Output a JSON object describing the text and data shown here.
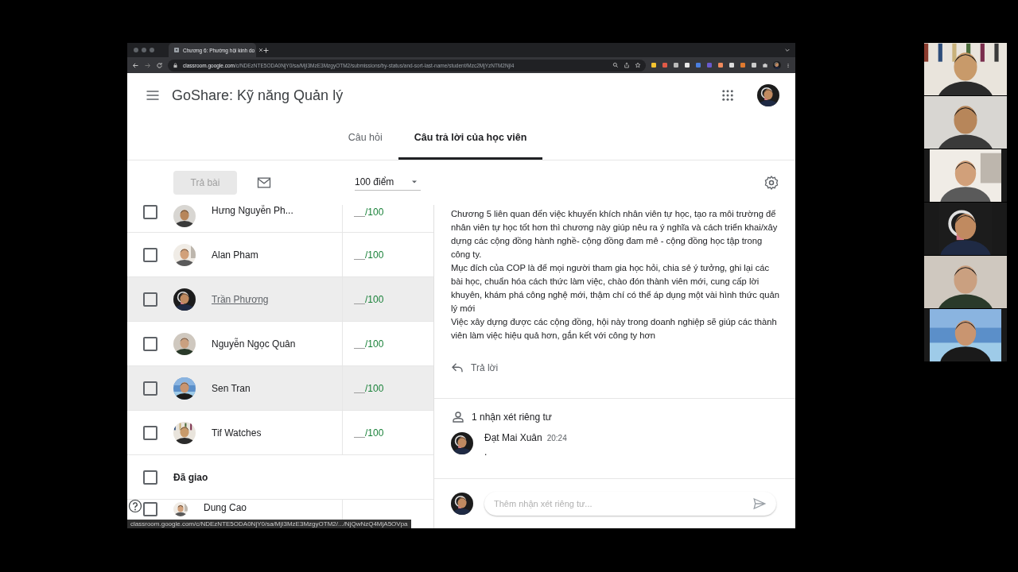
{
  "browser": {
    "tab_title": "Chương 6: Phường hội kinh do",
    "url_host": "classroom.google.com",
    "url_path": "/c/NDEzNTE5ODA0NjY0/sa/MjI3MzE3MzgyOTM2/submissions/by-status/and-sort-last-name/student/Mzc2MjYzNTM2NjI4"
  },
  "app": {
    "title": "GoShare: Kỹ năng Quản lý"
  },
  "tabs": [
    {
      "label": "Câu hỏi",
      "selected": false
    },
    {
      "label": "Câu trả lời của học viên",
      "selected": true
    }
  ],
  "toolbar": {
    "return_button": {
      "label": "Trả bài",
      "disabled": true
    },
    "points": "100 điểm"
  },
  "students": [
    {
      "kind": "student",
      "name": "Hưng Nguyễn Ph...",
      "grade": "/100",
      "checked": false,
      "highlighted": false,
      "hovered": false
    },
    {
      "kind": "student",
      "name": "Alan Pham",
      "grade": "/100",
      "checked": false,
      "highlighted": false,
      "hovered": false
    },
    {
      "kind": "student",
      "name": "Trần Phương",
      "grade": "/100",
      "checked": false,
      "highlighted": true,
      "hovered": true
    },
    {
      "kind": "student",
      "name": "Nguyễn Ngọc Quân",
      "grade": "/100",
      "checked": false,
      "highlighted": false,
      "hovered": false
    },
    {
      "kind": "student",
      "name": "Sen Tran",
      "grade": "/100",
      "checked": false,
      "highlighted": true,
      "hovered": false
    },
    {
      "kind": "student",
      "name": "Tif Watches",
      "grade": "/100",
      "checked": false,
      "highlighted": false,
      "hovered": false
    },
    {
      "kind": "group",
      "name": "Đã giao",
      "checked": false
    },
    {
      "kind": "student",
      "name": "Dung Cao",
      "checked": false,
      "highlighted": false,
      "hovered": false
    }
  ],
  "answer": {
    "paragraphs": [
      "Chương 5 liên quan đến việc khuyến khích nhân viên tự học, tạo ra môi trường để nhân viên tự học tốt hơn thì chương này giúp nêu ra ý nghĩa và cách triển khai/xây dựng các cộng đồng hành nghề- cộng đồng đam mê - cộng đồng học tập trong công ty.",
      "Mục đích của COP là để mọi người tham gia học hỏi, chia sẻ ý tưởng, ghi lại các bài học, chuẩn hóa cách thức làm việc, chào đón thành viên mới, cung cấp lời khuyên, khám phá công nghệ mới, thậm chí có thể áp dụng một vài hình thức quản lý mới",
      "Việc xây dựng được các cộng đồng, hội này trong doanh nghiệp sẽ giúp các thành viên làm việc hiệu quả hơn, gắn kết với công ty hơn"
    ]
  },
  "reply_button": "Trả lời",
  "private_comments": {
    "heading": "1 nhận xét riêng tư",
    "comments": [
      {
        "author": "Đạt Mai Xuân",
        "time": "20:24",
        "text": "."
      }
    ],
    "placeholder": "Thêm nhận xét riêng tư..."
  },
  "status_url": "classroom.google.com/c/NDEzNTE5ODA0NjY0/sa/MjI3MzE3MzgyOTM2/.../NjQwNzQ4MjA5OVpa"
}
